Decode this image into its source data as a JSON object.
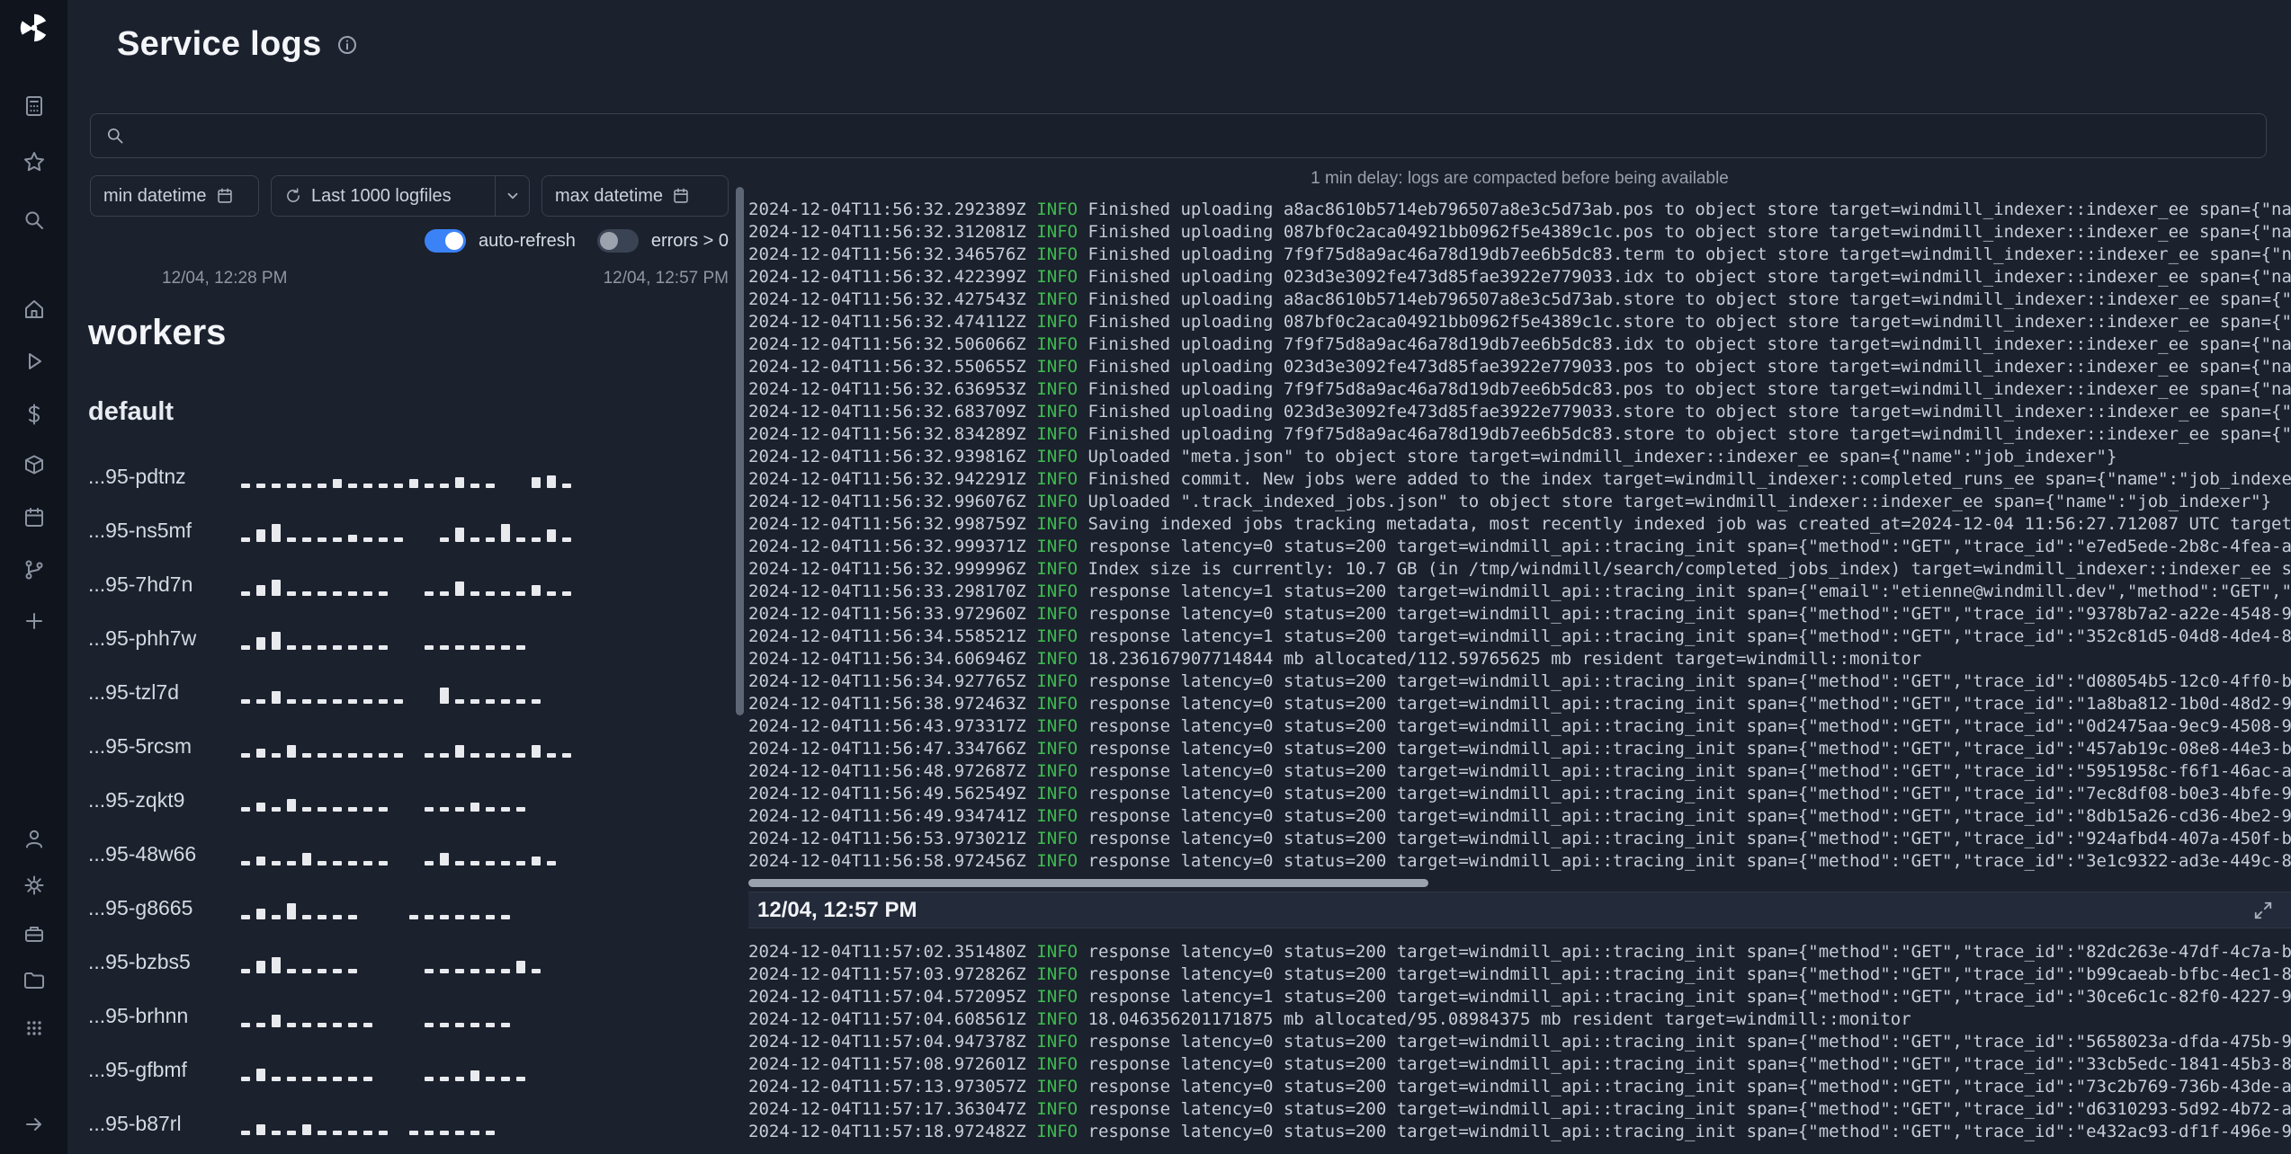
{
  "header": {
    "title": "Service logs"
  },
  "search": {
    "value": "",
    "placeholder": ""
  },
  "filters": {
    "min_datetime_label": "min datetime",
    "logfiles_label": "Last 1000 logfiles",
    "max_datetime_label": "max datetime",
    "auto_refresh_label": "auto-refresh",
    "auto_refresh_on": true,
    "errors_label": "errors > 0",
    "errors_on": false,
    "range_start": "12/04, 12:28 PM",
    "range_end": "12/04, 12:57 PM"
  },
  "workers": {
    "heading": "workers",
    "group": "default",
    "rows": [
      {
        "name": "...95-pdtnz",
        "bars": [
          5,
          5,
          5,
          5,
          5,
          5,
          10,
          5,
          5,
          5,
          5,
          10,
          5,
          5,
          12,
          5,
          5,
          0,
          0,
          12,
          14,
          5
        ]
      },
      {
        "name": "...95-ns5mf",
        "bars": [
          5,
          14,
          20,
          5,
          5,
          5,
          5,
          8,
          5,
          5,
          5,
          0,
          0,
          5,
          16,
          5,
          5,
          20,
          5,
          5,
          14,
          5
        ]
      },
      {
        "name": "...95-7hd7n",
        "bars": [
          5,
          12,
          18,
          5,
          5,
          5,
          5,
          5,
          5,
          5,
          0,
          0,
          5,
          5,
          16,
          5,
          5,
          5,
          5,
          12,
          5,
          5
        ]
      },
      {
        "name": "...95-phh7w",
        "bars": [
          5,
          14,
          20,
          5,
          5,
          5,
          5,
          5,
          5,
          5,
          0,
          0,
          5,
          5,
          5,
          5,
          5,
          5,
          5,
          0,
          0,
          0
        ]
      },
      {
        "name": "...95-tzl7d",
        "bars": [
          5,
          5,
          14,
          5,
          5,
          5,
          5,
          5,
          5,
          5,
          5,
          0,
          0,
          18,
          5,
          5,
          5,
          5,
          5,
          5,
          0,
          0
        ]
      },
      {
        "name": "...95-5rcsm",
        "bars": [
          5,
          10,
          5,
          14,
          5,
          5,
          5,
          5,
          5,
          5,
          5,
          0,
          5,
          5,
          14,
          5,
          5,
          5,
          5,
          14,
          5,
          5
        ]
      },
      {
        "name": "...95-zqkt9",
        "bars": [
          5,
          10,
          5,
          14,
          5,
          5,
          5,
          5,
          5,
          5,
          0,
          0,
          5,
          5,
          5,
          10,
          5,
          5,
          5,
          0,
          0,
          0
        ]
      },
      {
        "name": "...95-48w66",
        "bars": [
          5,
          10,
          5,
          5,
          14,
          5,
          5,
          5,
          5,
          5,
          0,
          0,
          5,
          14,
          5,
          5,
          5,
          5,
          5,
          10,
          5,
          0
        ]
      },
      {
        "name": "...95-g8665",
        "bars": [
          5,
          12,
          5,
          18,
          5,
          5,
          5,
          5,
          0,
          0,
          0,
          5,
          5,
          5,
          5,
          5,
          5,
          5,
          0,
          0,
          0,
          0
        ]
      },
      {
        "name": "...95-bzbs5",
        "bars": [
          5,
          14,
          18,
          5,
          5,
          5,
          5,
          5,
          0,
          0,
          0,
          0,
          5,
          5,
          5,
          5,
          5,
          5,
          14,
          5,
          0,
          0
        ]
      },
      {
        "name": "...95-brhnn",
        "bars": [
          5,
          5,
          14,
          5,
          5,
          5,
          5,
          5,
          5,
          0,
          0,
          0,
          5,
          5,
          5,
          5,
          5,
          5,
          0,
          0,
          0,
          0
        ]
      },
      {
        "name": "...95-gfbmf",
        "bars": [
          5,
          14,
          5,
          5,
          5,
          5,
          5,
          5,
          5,
          0,
          0,
          0,
          5,
          5,
          5,
          12,
          5,
          5,
          5,
          0,
          0,
          0
        ]
      },
      {
        "name": "...95-b87rl",
        "bars": [
          5,
          12,
          5,
          5,
          12,
          5,
          5,
          5,
          5,
          5,
          0,
          5,
          5,
          5,
          5,
          5,
          5,
          0,
          0,
          0,
          0,
          0
        ]
      }
    ]
  },
  "logs": {
    "delay_note": "1 min delay: logs are compacted before being available",
    "section_header": "12/04, 12:57 PM",
    "top_lines": [
      {
        "t": "2024-12-04T11:56:32.292389Z",
        "l": "INFO",
        "m": "Finished uploading a8ac8610b5714eb796507a8e3c5d73ab.pos to object store target=windmill_indexer::indexer_ee span={\"na"
      },
      {
        "t": "2024-12-04T11:56:32.312081Z",
        "l": "INFO",
        "m": "Finished uploading 087bf0c2aca04921bb0962f5e4389c1c.pos to object store target=windmill_indexer::indexer_ee span={\"na"
      },
      {
        "t": "2024-12-04T11:56:32.346576Z",
        "l": "INFO",
        "m": "Finished uploading 7f9f75d8a9ac46a78d19db7ee6b5dc83.term to object store target=windmill_indexer::indexer_ee span={\"n"
      },
      {
        "t": "2024-12-04T11:56:32.422399Z",
        "l": "INFO",
        "m": "Finished uploading 023d3e3092fe473d85fae3922e779033.idx to object store target=windmill_indexer::indexer_ee span={\"na"
      },
      {
        "t": "2024-12-04T11:56:32.427543Z",
        "l": "INFO",
        "m": "Finished uploading a8ac8610b5714eb796507a8e3c5d73ab.store to object store target=windmill_indexer::indexer_ee span={\""
      },
      {
        "t": "2024-12-04T11:56:32.474112Z",
        "l": "INFO",
        "m": "Finished uploading 087bf0c2aca04921bb0962f5e4389c1c.store to object store target=windmill_indexer::indexer_ee span={\""
      },
      {
        "t": "2024-12-04T11:56:32.506066Z",
        "l": "INFO",
        "m": "Finished uploading 7f9f75d8a9ac46a78d19db7ee6b5dc83.idx to object store target=windmill_indexer::indexer_ee span={\"na"
      },
      {
        "t": "2024-12-04T11:56:32.550655Z",
        "l": "INFO",
        "m": "Finished uploading 023d3e3092fe473d85fae3922e779033.pos to object store target=windmill_indexer::indexer_ee span={\"na"
      },
      {
        "t": "2024-12-04T11:56:32.636953Z",
        "l": "INFO",
        "m": "Finished uploading 7f9f75d8a9ac46a78d19db7ee6b5dc83.pos to object store target=windmill_indexer::indexer_ee span={\"na"
      },
      {
        "t": "2024-12-04T11:56:32.683709Z",
        "l": "INFO",
        "m": "Finished uploading 023d3e3092fe473d85fae3922e779033.store to object store target=windmill_indexer::indexer_ee span={\""
      },
      {
        "t": "2024-12-04T11:56:32.834289Z",
        "l": "INFO",
        "m": "Finished uploading 7f9f75d8a9ac46a78d19db7ee6b5dc83.store to object store target=windmill_indexer::indexer_ee span={\""
      },
      {
        "t": "2024-12-04T11:56:32.939816Z",
        "l": "INFO",
        "m": "Uploaded \"meta.json\" to object store target=windmill_indexer::indexer_ee span={\"name\":\"job_indexer\"}"
      },
      {
        "t": "2024-12-04T11:56:32.942291Z",
        "l": "INFO",
        "m": "Finished commit. New jobs were added to the index target=windmill_indexer::completed_runs_ee span={\"name\":\"job_indexe"
      },
      {
        "t": "2024-12-04T11:56:32.996076Z",
        "l": "INFO",
        "m": "Uploaded \".track_indexed_jobs.json\" to object store target=windmill_indexer::indexer_ee span={\"name\":\"job_indexer\"}"
      },
      {
        "t": "2024-12-04T11:56:32.998759Z",
        "l": "INFO",
        "m": "Saving indexed jobs tracking metadata, most recently indexed job was created_at=2024-12-04 11:56:27.712087 UTC target"
      },
      {
        "t": "2024-12-04T11:56:32.999371Z",
        "l": "INFO",
        "m": "response latency=0 status=200 target=windmill_api::tracing_init span={\"method\":\"GET\",\"trace_id\":\"e7ed5ede-2b8c-4fea-a"
      },
      {
        "t": "2024-12-04T11:56:32.999996Z",
        "l": "INFO",
        "m": "Index size is currently: 10.7 GB (in /tmp/windmill/search/completed_jobs_index) target=windmill_indexer::indexer_ee s"
      },
      {
        "t": "2024-12-04T11:56:33.298170Z",
        "l": "INFO",
        "m": "response latency=1 status=200 target=windmill_api::tracing_init span={\"email\":\"etienne@windmill.dev\",\"method\":\"GET\",\""
      },
      {
        "t": "2024-12-04T11:56:33.972960Z",
        "l": "INFO",
        "m": "response latency=0 status=200 target=windmill_api::tracing_init span={\"method\":\"GET\",\"trace_id\":\"9378b7a2-a22e-4548-9"
      },
      {
        "t": "2024-12-04T11:56:34.558521Z",
        "l": "INFO",
        "m": "response latency=1 status=200 target=windmill_api::tracing_init span={\"method\":\"GET\",\"trace_id\":\"352c81d5-04d8-4de4-8"
      },
      {
        "t": "2024-12-04T11:56:34.606946Z",
        "l": "INFO",
        "m": "18.236167907714844 mb allocated/112.59765625 mb resident target=windmill::monitor"
      },
      {
        "t": "2024-12-04T11:56:34.927765Z",
        "l": "INFO",
        "m": "response latency=0 status=200 target=windmill_api::tracing_init span={\"method\":\"GET\",\"trace_id\":\"d08054b5-12c0-4ff0-b"
      },
      {
        "t": "2024-12-04T11:56:38.972463Z",
        "l": "INFO",
        "m": "response latency=0 status=200 target=windmill_api::tracing_init span={\"method\":\"GET\",\"trace_id\":\"1a8ba812-1b0d-48d2-9"
      },
      {
        "t": "2024-12-04T11:56:43.973317Z",
        "l": "INFO",
        "m": "response latency=0 status=200 target=windmill_api::tracing_init span={\"method\":\"GET\",\"trace_id\":\"0d2475aa-9ec9-4508-9"
      },
      {
        "t": "2024-12-04T11:56:47.334766Z",
        "l": "INFO",
        "m": "response latency=0 status=200 target=windmill_api::tracing_init span={\"method\":\"GET\",\"trace_id\":\"457ab19c-08e8-44e3-b"
      },
      {
        "t": "2024-12-04T11:56:48.972687Z",
        "l": "INFO",
        "m": "response latency=0 status=200 target=windmill_api::tracing_init span={\"method\":\"GET\",\"trace_id\":\"5951958c-f6f1-46ac-a"
      },
      {
        "t": "2024-12-04T11:56:49.562549Z",
        "l": "INFO",
        "m": "response latency=0 status=200 target=windmill_api::tracing_init span={\"method\":\"GET\",\"trace_id\":\"7ec8df08-b0e3-4bfe-9"
      },
      {
        "t": "2024-12-04T11:56:49.934741Z",
        "l": "INFO",
        "m": "response latency=0 status=200 target=windmill_api::tracing_init span={\"method\":\"GET\",\"trace_id\":\"8db15a26-cd36-4be2-9"
      },
      {
        "t": "2024-12-04T11:56:53.973021Z",
        "l": "INFO",
        "m": "response latency=0 status=200 target=windmill_api::tracing_init span={\"method\":\"GET\",\"trace_id\":\"924afbd4-407a-450f-b"
      },
      {
        "t": "2024-12-04T11:56:58.972456Z",
        "l": "INFO",
        "m": "response latency=0 status=200 target=windmill_api::tracing_init span={\"method\":\"GET\",\"trace_id\":\"3e1c9322-ad3e-449c-8"
      }
    ],
    "bottom_lines": [
      {
        "t": "2024-12-04T11:57:02.351480Z",
        "l": "INFO",
        "m": "response latency=0 status=200 target=windmill_api::tracing_init span={\"method\":\"GET\",\"trace_id\":\"82dc263e-47df-4c7a-b"
      },
      {
        "t": "2024-12-04T11:57:03.972826Z",
        "l": "INFO",
        "m": "response latency=0 status=200 target=windmill_api::tracing_init span={\"method\":\"GET\",\"trace_id\":\"b99caeab-bfbc-4ec1-8"
      },
      {
        "t": "2024-12-04T11:57:04.572095Z",
        "l": "INFO",
        "m": "response latency=1 status=200 target=windmill_api::tracing_init span={\"method\":\"GET\",\"trace_id\":\"30ce6c1c-82f0-4227-9"
      },
      {
        "t": "2024-12-04T11:57:04.608561Z",
        "l": "INFO",
        "m": "18.046356201171875 mb allocated/95.08984375 mb resident target=windmill::monitor"
      },
      {
        "t": "2024-12-04T11:57:04.947378Z",
        "l": "INFO",
        "m": "response latency=0 status=200 target=windmill_api::tracing_init span={\"method\":\"GET\",\"trace_id\":\"5658023a-dfda-475b-9"
      },
      {
        "t": "2024-12-04T11:57:08.972601Z",
        "l": "INFO",
        "m": "response latency=0 status=200 target=windmill_api::tracing_init span={\"method\":\"GET\",\"trace_id\":\"33cb5edc-1841-45b3-8"
      },
      {
        "t": "2024-12-04T11:57:13.973057Z",
        "l": "INFO",
        "m": "response latency=0 status=200 target=windmill_api::tracing_init span={\"method\":\"GET\",\"trace_id\":\"73c2b769-736b-43de-a"
      },
      {
        "t": "2024-12-04T11:57:17.363047Z",
        "l": "INFO",
        "m": "response latency=0 status=200 target=windmill_api::tracing_init span={\"method\":\"GET\",\"trace_id\":\"d6310293-5d92-4b72-a"
      },
      {
        "t": "2024-12-04T11:57:18.972482Z",
        "l": "INFO",
        "m": "response latency=0 status=200 target=windmill_api::tracing_init span={\"method\":\"GET\",\"trace_id\":\"e432ac93-df1f-496e-9"
      }
    ]
  },
  "colors": {
    "accent_blue": "#3b82f6",
    "log_info_green": "#3fb950",
    "background": "#1b212d",
    "sidebar_background": "#0f141d"
  }
}
